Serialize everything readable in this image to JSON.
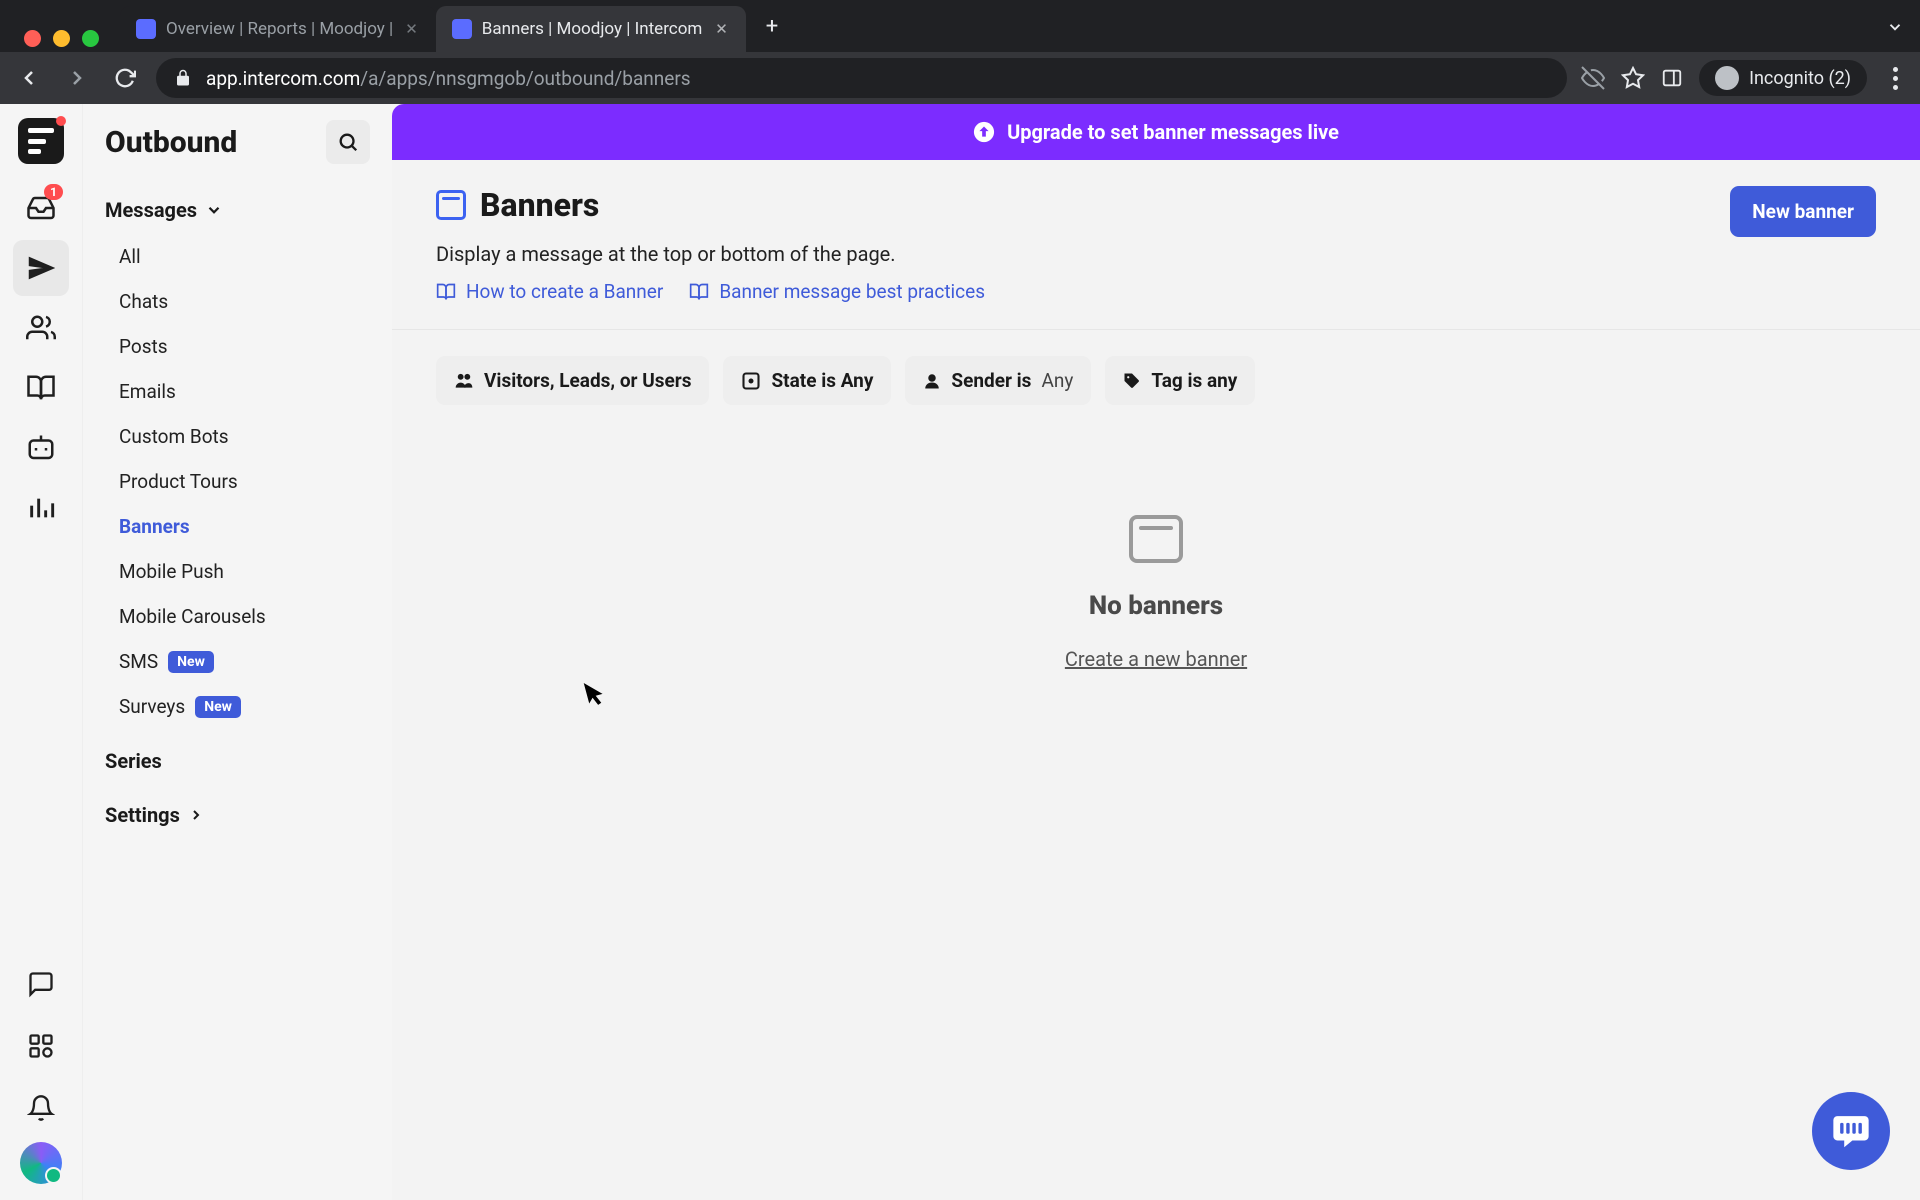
{
  "browser": {
    "tabs": [
      {
        "title": "Overview | Reports | Moodjoy |",
        "active": false
      },
      {
        "title": "Banners | Moodjoy | Intercom",
        "active": true
      }
    ],
    "url_host": "app.intercom.com",
    "url_path": "/a/apps/nnsgmgob/outbound/banners",
    "incognito_label": "Incognito (2)"
  },
  "rail": {
    "inbox_badge": "1"
  },
  "sidebar": {
    "title": "Outbound",
    "section_messages": "Messages",
    "items": [
      {
        "label": "All"
      },
      {
        "label": "Chats"
      },
      {
        "label": "Posts"
      },
      {
        "label": "Emails"
      },
      {
        "label": "Custom Bots"
      },
      {
        "label": "Product Tours"
      },
      {
        "label": "Banners",
        "active": true
      },
      {
        "label": "Mobile Push"
      },
      {
        "label": "Mobile Carousels"
      },
      {
        "label": "SMS",
        "badge": "New"
      },
      {
        "label": "Surveys",
        "badge": "New"
      }
    ],
    "series_label": "Series",
    "settings_label": "Settings"
  },
  "promo": {
    "text": "Upgrade to set banner messages live"
  },
  "page": {
    "title": "Banners",
    "subtitle": "Display a message at the top or bottom of the page.",
    "help_link_1": "How to create a Banner",
    "help_link_2": "Banner message best practices",
    "new_button": "New banner"
  },
  "filters": {
    "audience": "Visitors, Leads, or Users",
    "state_label": "State is Any",
    "sender_label": "Sender is",
    "sender_value": "Any",
    "tag_label": "Tag is any"
  },
  "empty": {
    "title": "No banners",
    "link": "Create a new banner"
  }
}
